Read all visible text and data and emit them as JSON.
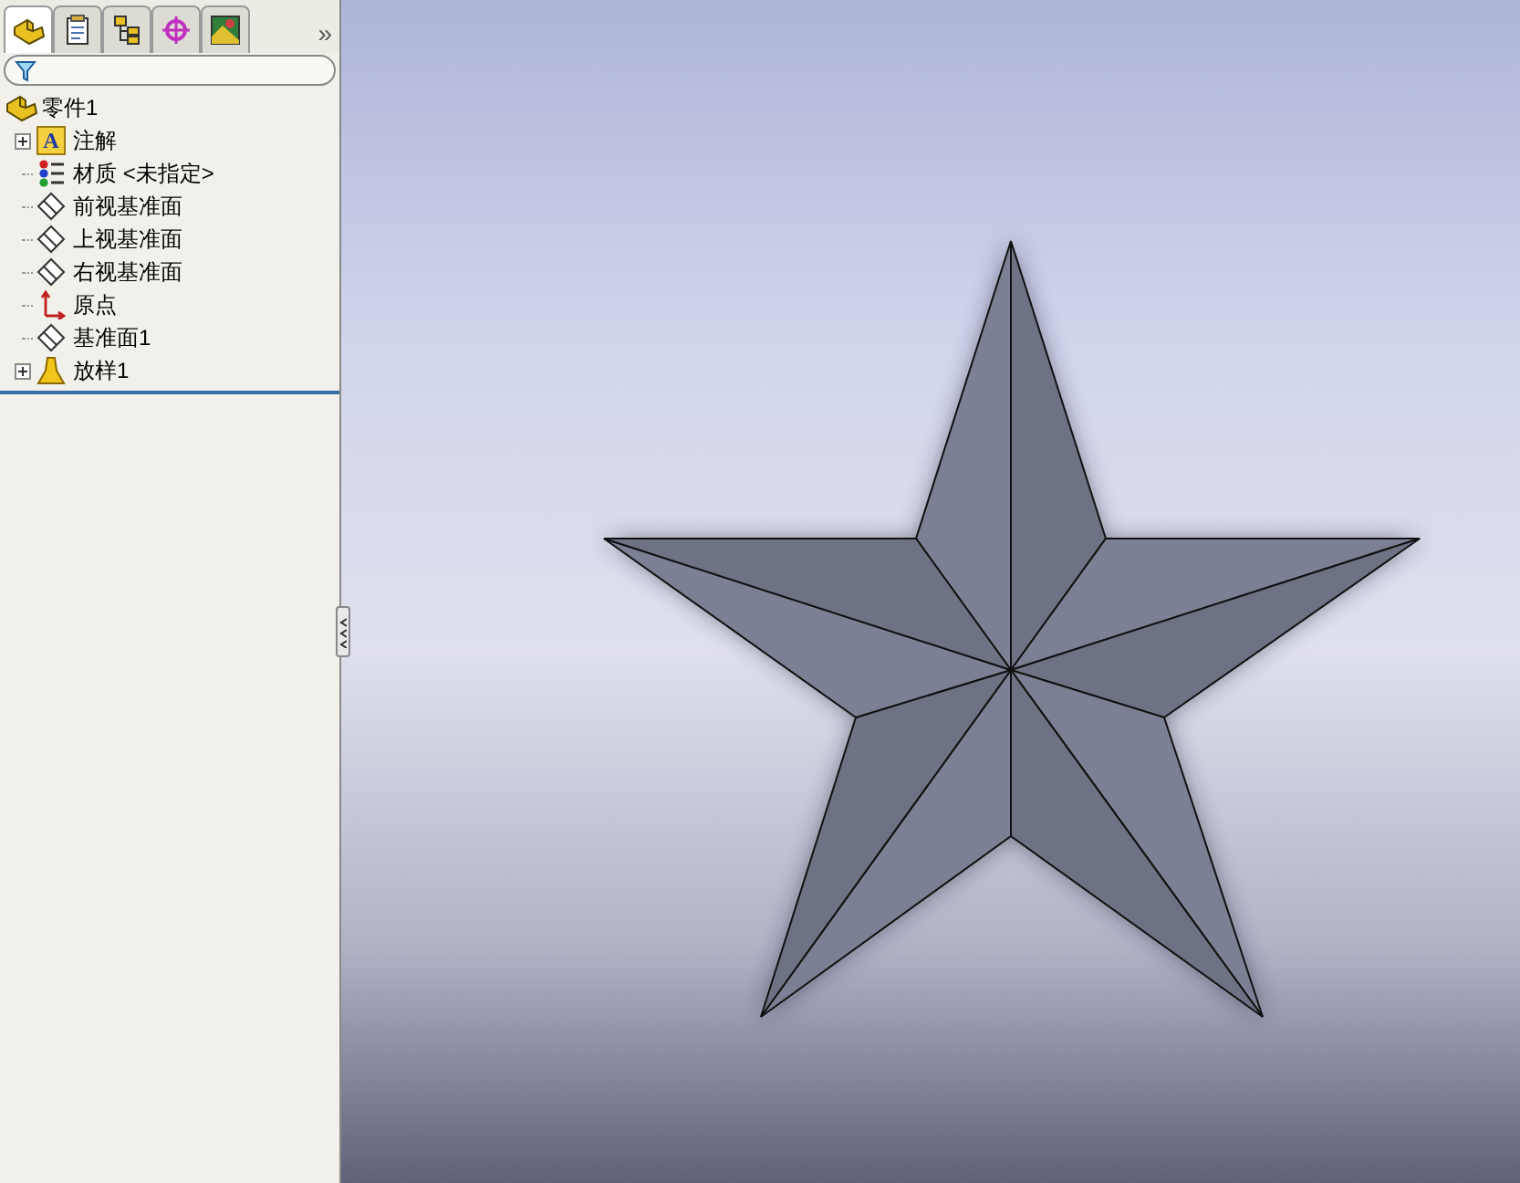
{
  "panel_tabs": [
    {
      "kind": "part",
      "selected": true
    },
    {
      "kind": "properties",
      "selected": false
    },
    {
      "kind": "config",
      "selected": false
    },
    {
      "kind": "target",
      "selected": false
    },
    {
      "kind": "display",
      "selected": false
    }
  ],
  "more_tabs": "»",
  "tree": {
    "label": "零件1",
    "kind": "part",
    "children": [
      {
        "label": "注解",
        "kind": "annotation",
        "expandable": true,
        "icon_text": "A"
      },
      {
        "label": "材质 <未指定>",
        "kind": "material",
        "expandable": false
      },
      {
        "label": "前视基准面",
        "kind": "plane",
        "expandable": false
      },
      {
        "label": "上视基准面",
        "kind": "plane",
        "expandable": false
      },
      {
        "label": "右视基准面",
        "kind": "plane",
        "expandable": false
      },
      {
        "label": "原点",
        "kind": "origin",
        "expandable": false
      },
      {
        "label": "基准面1",
        "kind": "plane",
        "expandable": false
      },
      {
        "label": "放样1",
        "kind": "loft",
        "expandable": true
      }
    ]
  }
}
